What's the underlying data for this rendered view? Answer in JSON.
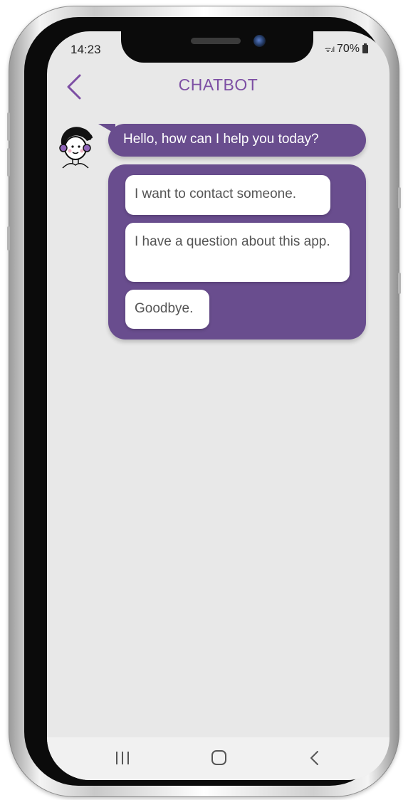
{
  "status_bar": {
    "time": "14:23",
    "signal": "ᯤ.ıl",
    "battery": "70%"
  },
  "header": {
    "title": "CHATBOT"
  },
  "chat": {
    "bot_message": "Hello, how can I help you today?",
    "options": [
      {
        "label": "I want to contact someone."
      },
      {
        "label": "I have a question about this app."
      },
      {
        "label": "Goodbye."
      }
    ]
  },
  "colors": {
    "accent_purple": "#694d8e",
    "title_purple": "#7d4fa4",
    "screen_background": "#e8e8e8",
    "option_text": "#555555"
  },
  "icons": {
    "back": "chevron-left-icon",
    "avatar": "bot-avatar-icon",
    "nav_recents": "recent-apps-icon",
    "nav_home": "home-icon",
    "nav_back": "back-icon"
  }
}
